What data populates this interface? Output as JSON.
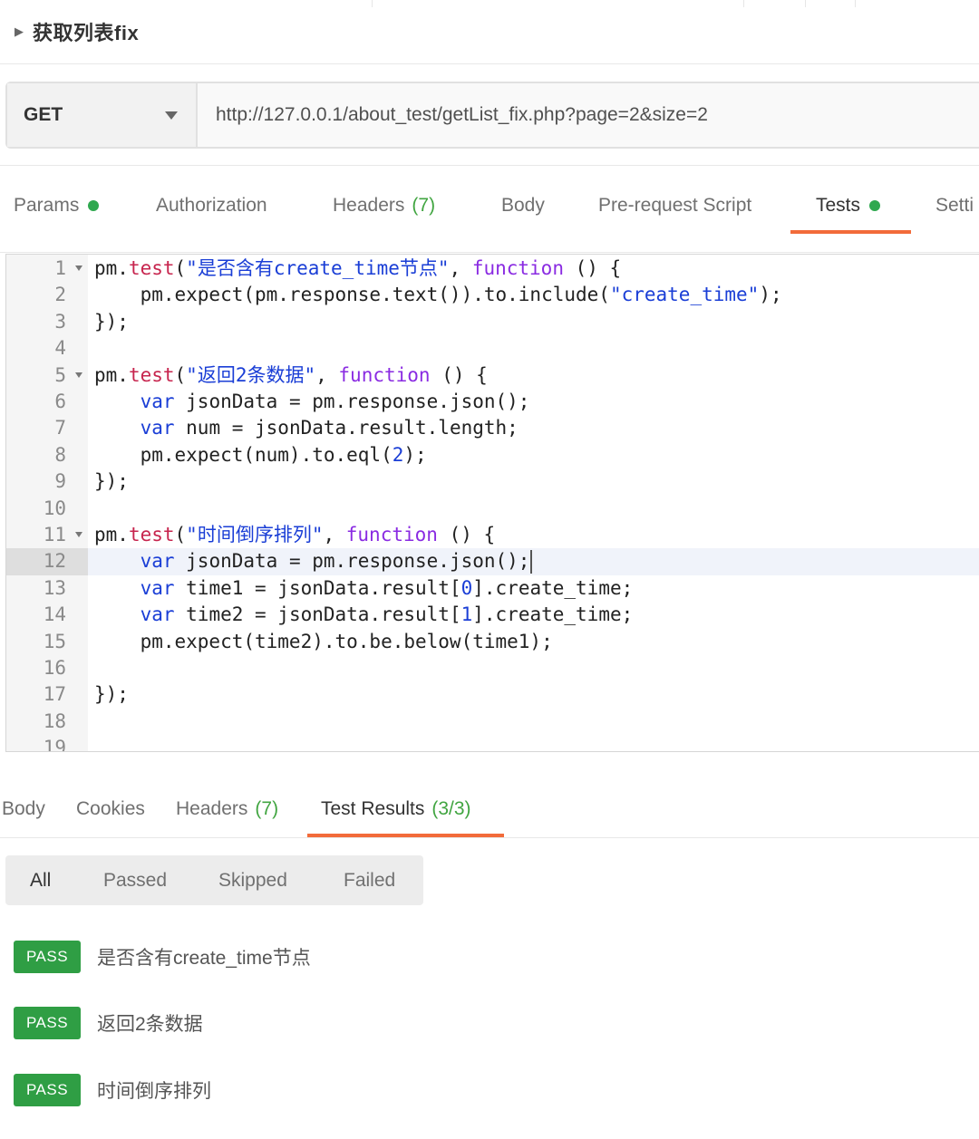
{
  "request": {
    "name": "获取列表fix",
    "method": "GET",
    "url": "http://127.0.0.1/about_test/getList_fix.php?page=2&size=2"
  },
  "request_tabs": [
    {
      "label": "Params",
      "dot": true
    },
    {
      "label": "Authorization"
    },
    {
      "label": "Headers",
      "count": "(7)"
    },
    {
      "label": "Body"
    },
    {
      "label": "Pre-request Script"
    },
    {
      "label": "Tests",
      "dot": true,
      "active": true
    },
    {
      "label": "Setti"
    }
  ],
  "editor": {
    "active_line": 12,
    "line_numbers": [
      "1",
      "2",
      "3",
      "4",
      "5",
      "6",
      "7",
      "8",
      "9",
      "10",
      "11",
      "12",
      "13",
      "14",
      "15",
      "16",
      "17",
      "18",
      "19"
    ],
    "lines": [
      "pm.test(\"是否含有create_time节点\", function () {",
      "    pm.expect(pm.response.text()).to.include(\"create_time\");",
      "});",
      "",
      "pm.test(\"返回2条数据\", function () {",
      "    var jsonData = pm.response.json();",
      "    var num = jsonData.result.length;",
      "    pm.expect(num).to.eql(2);",
      "});",
      "",
      "pm.test(\"时间倒序排列\", function () {",
      "    var jsonData = pm.response.json();",
      "    var time1 = jsonData.result[0].create_time;",
      "    var time2 = jsonData.result[1].create_time;",
      "    pm.expect(time2).to.be.below(time1);",
      "",
      "});",
      "",
      ""
    ]
  },
  "response_tabs": [
    {
      "label": "Body"
    },
    {
      "label": "Cookies"
    },
    {
      "label": "Headers",
      "count": "(7)"
    },
    {
      "label": "Test Results",
      "count": "(3/3)",
      "active": true
    }
  ],
  "filters": [
    "All",
    "Passed",
    "Skipped",
    "Failed"
  ],
  "results": [
    {
      "status": "PASS",
      "name": "是否含有create_time节点"
    },
    {
      "status": "PASS",
      "name": "返回2条数据"
    },
    {
      "status": "PASS",
      "name": "时间倒序排列"
    }
  ],
  "colors": {
    "accent": "#f26b3a",
    "pass": "#2f9e44",
    "dot": "#2fa84f",
    "count": "#41a541"
  }
}
